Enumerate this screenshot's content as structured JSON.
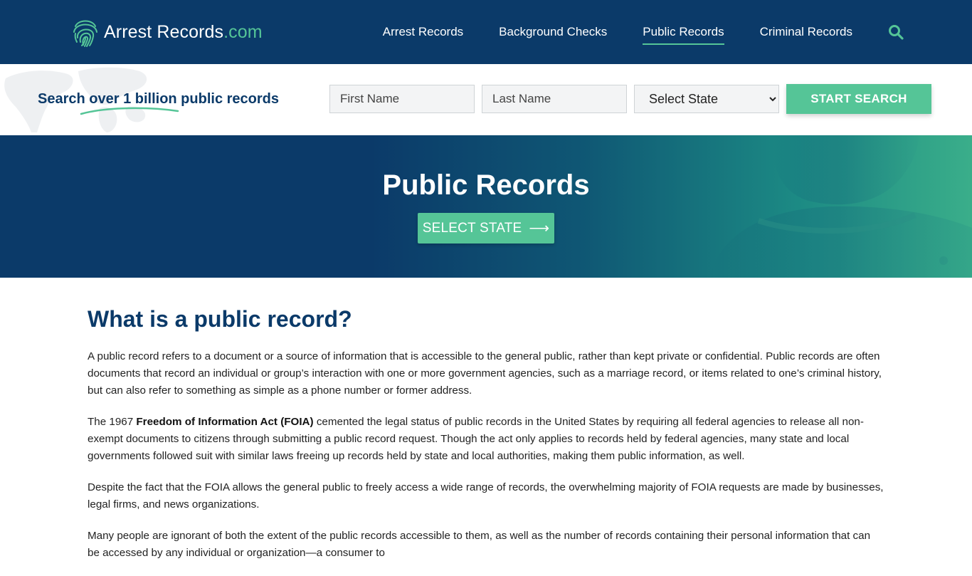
{
  "header": {
    "logo_main": "Arrest Records",
    "logo_tld": ".com",
    "nav": [
      {
        "label": "Arrest Records"
      },
      {
        "label": "Background Checks"
      },
      {
        "label": "Public Records"
      },
      {
        "label": "Criminal Records"
      }
    ],
    "active_nav": "Public Records",
    "search_icon": "search-icon"
  },
  "search": {
    "tagline": "Search over 1 billion public records",
    "first_name_placeholder": "First Name",
    "last_name_placeholder": "Last Name",
    "state_selected": "Select State",
    "button_label": "START SEARCH"
  },
  "hero": {
    "title": "Public Records",
    "button_label": "SELECT STATE",
    "button_icon": "arrow-right-icon"
  },
  "article": {
    "heading": "What is a public record?",
    "p1": "A public record refers to a document or a source of information that is accessible to the general public, rather than kept private or confidential. Public records are often documents that record an individual or group’s interaction with one or more government agencies, such as a marriage record, or items related to one’s criminal history, but can also refer to something as simple as a phone number or former address.",
    "p2_pre": "The 1967 ",
    "p2_bold": "Freedom of Information Act (FOIA)",
    "p2_post": " cemented the legal status of public records in the United States by requiring all federal agencies to release all non-exempt documents to citizens through submitting a public record request. Though the act only applies to records held by federal agencies, many state and local governments followed suit with similar laws freeing up records held by state and local authorities, making them public information, as well.",
    "p3": "Despite the fact that the FOIA allows the general public to freely access a wide range of records, the overwhelming majority of FOIA requests are made by businesses, legal firms, and news organizations.",
    "p4": "Many people are ignorant of both the extent of the public records accessible to them, as well as the number of records containing their personal information that can be accessed by any individual or organization—a consumer to"
  },
  "colors": {
    "navy": "#0b3a69",
    "green": "#55c597"
  }
}
